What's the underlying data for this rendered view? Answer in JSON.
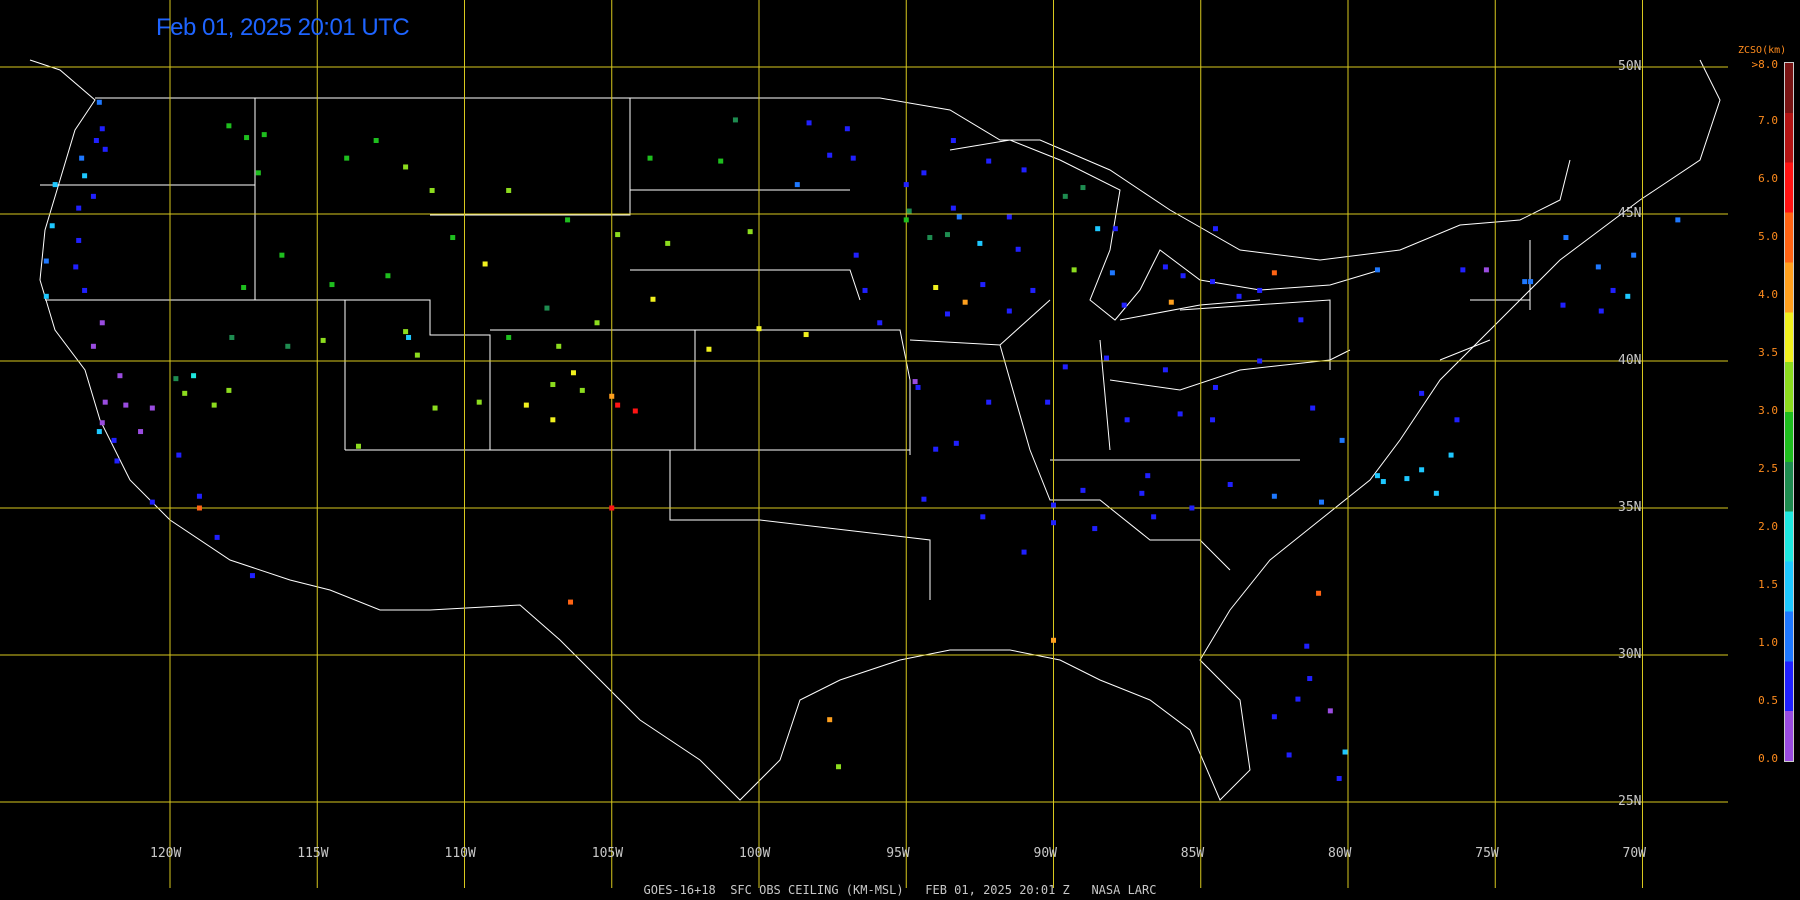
{
  "timestamp": "Feb 01, 2025 20:01 UTC",
  "footer": "GOES-16+18  SFC OBS CEILING (KM-MSL)   FEB 01, 2025 20:01 Z   NASA LARC",
  "map": {
    "lat_lines": [
      {
        "lat": 50,
        "label": "50N"
      },
      {
        "lat": 45,
        "label": "45N"
      },
      {
        "lat": 40,
        "label": "40N"
      },
      {
        "lat": 35,
        "label": "35N"
      },
      {
        "lat": 30,
        "label": "30N"
      },
      {
        "lat": 25,
        "label": "25N"
      }
    ],
    "lon_lines": [
      {
        "lon": -120,
        "label": "120W"
      },
      {
        "lon": -115,
        "label": "115W"
      },
      {
        "lon": -110,
        "label": "110W"
      },
      {
        "lon": -105,
        "label": "105W"
      },
      {
        "lon": -100,
        "label": "100W"
      },
      {
        "lon": -95,
        "label": "95W"
      },
      {
        "lon": -90,
        "label": "90W"
      },
      {
        "lon": -85,
        "label": "85W"
      },
      {
        "lon": -80,
        "label": "80W"
      },
      {
        "lon": -75,
        "label": "75W"
      },
      {
        "lon": -70,
        "label": "70W"
      }
    ],
    "grid_color": "#d8c81e",
    "border_color": "#ffffff"
  },
  "colorbar": {
    "title": "ZCSO(km)",
    "top_label": ">8.0",
    "ticks": [
      "0.0",
      "0.5",
      "1.0",
      "1.5",
      "2.0",
      "2.5",
      "3.0",
      "3.5",
      "4.0",
      "5.0",
      "6.0",
      "7.0"
    ],
    "colors": [
      "#9a4ce0",
      "#2020ff",
      "#1e78ff",
      "#1ec8ff",
      "#1ee8e0",
      "#1e8c50",
      "#1ebe1e",
      "#8cdc1e",
      "#f0f01e",
      "#ffa01e",
      "#ff6414",
      "#ff1414",
      "#b41414",
      "#781414"
    ],
    "label_color": "#ff8c1e"
  },
  "chart_data": {
    "type": "scatter",
    "units": "km",
    "points": [
      {
        "lon": -122.4,
        "lat": 48.8,
        "v": 1.2
      },
      {
        "lon": -122.3,
        "lat": 47.9,
        "v": 0.8
      },
      {
        "lon": -122.5,
        "lat": 47.5,
        "v": 0.8
      },
      {
        "lon": -122.2,
        "lat": 47.2,
        "v": 0.8
      },
      {
        "lon": -123.0,
        "lat": 46.9,
        "v": 1.0
      },
      {
        "lon": -122.9,
        "lat": 46.3,
        "v": 1.8
      },
      {
        "lon": -122.6,
        "lat": 45.6,
        "v": 0.8
      },
      {
        "lon": -123.1,
        "lat": 45.2,
        "v": 0.8
      },
      {
        "lon": -123.9,
        "lat": 46.0,
        "v": 1.8
      },
      {
        "lon": -124.0,
        "lat": 44.6,
        "v": 1.8
      },
      {
        "lon": -123.1,
        "lat": 44.1,
        "v": 0.8
      },
      {
        "lon": -123.2,
        "lat": 43.2,
        "v": 0.8
      },
      {
        "lon": -124.2,
        "lat": 43.4,
        "v": 1.2
      },
      {
        "lon": -124.2,
        "lat": 42.2,
        "v": 1.8
      },
      {
        "lon": -122.9,
        "lat": 42.4,
        "v": 0.8
      },
      {
        "lon": -122.3,
        "lat": 41.3,
        "v": 0.3
      },
      {
        "lon": -122.6,
        "lat": 40.5,
        "v": 0.3
      },
      {
        "lon": -121.7,
        "lat": 39.5,
        "v": 0.3
      },
      {
        "lon": -122.2,
        "lat": 38.6,
        "v": 0.3
      },
      {
        "lon": -121.5,
        "lat": 38.5,
        "v": 0.3
      },
      {
        "lon": -122.3,
        "lat": 37.9,
        "v": 0.3
      },
      {
        "lon": -122.4,
        "lat": 37.6,
        "v": 1.8
      },
      {
        "lon": -121.9,
        "lat": 37.3,
        "v": 0.8
      },
      {
        "lon": -121.8,
        "lat": 36.6,
        "v": 0.8
      },
      {
        "lon": -121.0,
        "lat": 37.6,
        "v": 0.3
      },
      {
        "lon": -120.6,
        "lat": 38.4,
        "v": 0.3
      },
      {
        "lon": -119.7,
        "lat": 36.8,
        "v": 0.8
      },
      {
        "lon": -120.6,
        "lat": 35.2,
        "v": 0.8
      },
      {
        "lon": -119.0,
        "lat": 35.4,
        "v": 0.8
      },
      {
        "lon": -118.4,
        "lat": 34.0,
        "v": 0.8
      },
      {
        "lon": -117.2,
        "lat": 32.7,
        "v": 0.8
      },
      {
        "lon": -119.2,
        "lat": 39.5,
        "v": 2.2
      },
      {
        "lon": -119.8,
        "lat": 39.4,
        "v": 2.7
      },
      {
        "lon": -119.5,
        "lat": 38.9,
        "v": 3.6
      },
      {
        "lon": -118.5,
        "lat": 38.5,
        "v": 3.6
      },
      {
        "lon": -118.0,
        "lat": 39.0,
        "v": 3.6
      },
      {
        "lon": -119.0,
        "lat": 35.0,
        "v": 6.5
      },
      {
        "lon": -117.9,
        "lat": 40.8,
        "v": 2.7
      },
      {
        "lon": -116.0,
        "lat": 40.5,
        "v": 2.7
      },
      {
        "lon": -114.8,
        "lat": 40.7,
        "v": 3.6
      },
      {
        "lon": -117.5,
        "lat": 42.5,
        "v": 3.0
      },
      {
        "lon": -116.2,
        "lat": 43.6,
        "v": 3.0
      },
      {
        "lon": -114.5,
        "lat": 42.6,
        "v": 3.0
      },
      {
        "lon": -112.6,
        "lat": 42.9,
        "v": 3.0
      },
      {
        "lon": -117.0,
        "lat": 46.4,
        "v": 3.0
      },
      {
        "lon": -117.4,
        "lat": 47.6,
        "v": 3.0
      },
      {
        "lon": -118.0,
        "lat": 48.0,
        "v": 3.0
      },
      {
        "lon": -116.8,
        "lat": 47.7,
        "v": 3.0
      },
      {
        "lon": -113.0,
        "lat": 47.5,
        "v": 3.0
      },
      {
        "lon": -114.0,
        "lat": 46.9,
        "v": 3.0
      },
      {
        "lon": -112.0,
        "lat": 46.6,
        "v": 3.6
      },
      {
        "lon": -111.1,
        "lat": 45.8,
        "v": 3.6
      },
      {
        "lon": -108.5,
        "lat": 45.8,
        "v": 3.6
      },
      {
        "lon": -110.4,
        "lat": 44.2,
        "v": 3.0
      },
      {
        "lon": -109.3,
        "lat": 43.3,
        "v": 4.5
      },
      {
        "lon": -106.5,
        "lat": 44.8,
        "v": 3.0
      },
      {
        "lon": -104.8,
        "lat": 44.3,
        "v": 3.6
      },
      {
        "lon": -105.5,
        "lat": 41.3,
        "v": 3.6
      },
      {
        "lon": -107.2,
        "lat": 41.8,
        "v": 2.7
      },
      {
        "lon": -108.5,
        "lat": 40.8,
        "v": 3.0
      },
      {
        "lon": -106.8,
        "lat": 40.5,
        "v": 3.6
      },
      {
        "lon": -106.3,
        "lat": 39.6,
        "v": 4.5
      },
      {
        "lon": -107.0,
        "lat": 39.2,
        "v": 3.6
      },
      {
        "lon": -106.0,
        "lat": 39.0,
        "v": 3.6
      },
      {
        "lon": -105.0,
        "lat": 38.8,
        "v": 5.5
      },
      {
        "lon": -104.8,
        "lat": 38.5,
        "v": 7.5
      },
      {
        "lon": -104.2,
        "lat": 38.3,
        "v": 7.5
      },
      {
        "lon": -107.9,
        "lat": 38.5,
        "v": 4.5
      },
      {
        "lon": -107.0,
        "lat": 38.0,
        "v": 4.5
      },
      {
        "lon": -112.0,
        "lat": 41.0,
        "v": 3.6
      },
      {
        "lon": -111.9,
        "lat": 40.8,
        "v": 1.8
      },
      {
        "lon": -111.6,
        "lat": 40.2,
        "v": 3.6
      },
      {
        "lon": -113.6,
        "lat": 37.1,
        "v": 3.6
      },
      {
        "lon": -111.0,
        "lat": 38.4,
        "v": 3.6
      },
      {
        "lon": -109.5,
        "lat": 38.6,
        "v": 3.6
      },
      {
        "lon": -103.7,
        "lat": 46.9,
        "v": 3.0
      },
      {
        "lon": -101.3,
        "lat": 46.8,
        "v": 3.0
      },
      {
        "lon": -100.8,
        "lat": 48.2,
        "v": 2.7
      },
      {
        "lon": -98.3,
        "lat": 48.1,
        "v": 0.8
      },
      {
        "lon": -97.0,
        "lat": 47.9,
        "v": 0.8
      },
      {
        "lon": -97.6,
        "lat": 47.0,
        "v": 0.8
      },
      {
        "lon": -96.8,
        "lat": 46.9,
        "v": 0.8
      },
      {
        "lon": -98.7,
        "lat": 46.0,
        "v": 1.2
      },
      {
        "lon": -100.3,
        "lat": 44.4,
        "v": 3.6
      },
      {
        "lon": -103.1,
        "lat": 44.0,
        "v": 3.6
      },
      {
        "lon": -96.7,
        "lat": 43.6,
        "v": 0.8
      },
      {
        "lon": -96.4,
        "lat": 42.4,
        "v": 0.8
      },
      {
        "lon": -95.9,
        "lat": 41.3,
        "v": 0.8
      },
      {
        "lon": -98.4,
        "lat": 40.9,
        "v": 4.5
      },
      {
        "lon": -100.0,
        "lat": 41.1,
        "v": 4.5
      },
      {
        "lon": -101.7,
        "lat": 40.4,
        "v": 4.5
      },
      {
        "lon": -103.6,
        "lat": 42.1,
        "v": 4.5
      },
      {
        "lon": -93.2,
        "lat": 44.9,
        "v": 1.2
      },
      {
        "lon": -93.4,
        "lat": 45.2,
        "v": 0.8
      },
      {
        "lon": -94.4,
        "lat": 46.4,
        "v": 0.8
      },
      {
        "lon": -92.2,
        "lat": 46.8,
        "v": 0.8
      },
      {
        "lon": -93.4,
        "lat": 47.5,
        "v": 0.8
      },
      {
        "lon": -95.0,
        "lat": 46.0,
        "v": 0.8
      },
      {
        "lon": -94.9,
        "lat": 45.1,
        "v": 2.7
      },
      {
        "lon": -93.6,
        "lat": 44.3,
        "v": 2.7
      },
      {
        "lon": -92.5,
        "lat": 44.0,
        "v": 1.8
      },
      {
        "lon": -94.2,
        "lat": 44.2,
        "v": 2.7
      },
      {
        "lon": -95.0,
        "lat": 44.8,
        "v": 3.0
      },
      {
        "lon": -91.5,
        "lat": 44.9,
        "v": 0.8
      },
      {
        "lon": -91.0,
        "lat": 46.5,
        "v": 0.8
      },
      {
        "lon": -89.6,
        "lat": 45.6,
        "v": 2.7
      },
      {
        "lon": -89.0,
        "lat": 45.9,
        "v": 2.7
      },
      {
        "lon": -88.5,
        "lat": 44.5,
        "v": 1.8
      },
      {
        "lon": -89.3,
        "lat": 43.1,
        "v": 3.6
      },
      {
        "lon": -88.0,
        "lat": 43.0,
        "v": 1.2
      },
      {
        "lon": -87.9,
        "lat": 44.5,
        "v": 0.8
      },
      {
        "lon": -87.6,
        "lat": 41.9,
        "v": 0.8
      },
      {
        "lon": -89.6,
        "lat": 39.8,
        "v": 0.8
      },
      {
        "lon": -88.2,
        "lat": 40.1,
        "v": 0.8
      },
      {
        "lon": -90.2,
        "lat": 38.6,
        "v": 0.8
      },
      {
        "lon": -91.2,
        "lat": 43.8,
        "v": 0.8
      },
      {
        "lon": -91.5,
        "lat": 41.7,
        "v": 0.8
      },
      {
        "lon": -93.6,
        "lat": 41.6,
        "v": 0.8
      },
      {
        "lon": -93.0,
        "lat": 42.0,
        "v": 5.0
      },
      {
        "lon": -94.0,
        "lat": 42.5,
        "v": 4.5
      },
      {
        "lon": -92.4,
        "lat": 42.6,
        "v": 0.8
      },
      {
        "lon": -90.7,
        "lat": 42.4,
        "v": 0.8
      },
      {
        "lon": -94.6,
        "lat": 39.1,
        "v": 0.8
      },
      {
        "lon": -94.7,
        "lat": 39.3,
        "v": 0.3
      },
      {
        "lon": -93.3,
        "lat": 37.2,
        "v": 0.8
      },
      {
        "lon": -92.2,
        "lat": 38.6,
        "v": 0.8
      },
      {
        "lon": -94.0,
        "lat": 37.0,
        "v": 0.8
      },
      {
        "lon": -92.4,
        "lat": 34.7,
        "v": 0.8
      },
      {
        "lon": -94.4,
        "lat": 35.3,
        "v": 0.8
      },
      {
        "lon": -90.0,
        "lat": 35.1,
        "v": 0.8
      },
      {
        "lon": -89.0,
        "lat": 35.6,
        "v": 0.8
      },
      {
        "lon": -86.8,
        "lat": 36.1,
        "v": 0.8
      },
      {
        "lon": -85.3,
        "lat": 35.0,
        "v": 0.8
      },
      {
        "lon": -84.0,
        "lat": 35.8,
        "v": 0.8
      },
      {
        "lon": -86.6,
        "lat": 34.7,
        "v": 0.8
      },
      {
        "lon": -87.0,
        "lat": 35.5,
        "v": 0.8
      },
      {
        "lon": -88.6,
        "lat": 34.3,
        "v": 0.8
      },
      {
        "lon": -90.0,
        "lat": 34.5,
        "v": 0.8
      },
      {
        "lon": -91.0,
        "lat": 33.5,
        "v": 0.8
      },
      {
        "lon": -85.7,
        "lat": 38.2,
        "v": 0.8
      },
      {
        "lon": -84.6,
        "lat": 38.0,
        "v": 0.8
      },
      {
        "lon": -84.5,
        "lat": 39.1,
        "v": 0.8
      },
      {
        "lon": -83.0,
        "lat": 40.0,
        "v": 0.8
      },
      {
        "lon": -81.6,
        "lat": 41.4,
        "v": 0.8
      },
      {
        "lon": -83.7,
        "lat": 42.2,
        "v": 0.8
      },
      {
        "lon": -83.0,
        "lat": 42.4,
        "v": 0.8
      },
      {
        "lon": -85.6,
        "lat": 42.9,
        "v": 0.8
      },
      {
        "lon": -84.6,
        "lat": 42.7,
        "v": 0.8
      },
      {
        "lon": -86.2,
        "lat": 43.2,
        "v": 0.8
      },
      {
        "lon": -84.5,
        "lat": 44.5,
        "v": 0.8
      },
      {
        "lon": -82.5,
        "lat": 43.0,
        "v": 6.5
      },
      {
        "lon": -86.0,
        "lat": 42.0,
        "v": 5.5
      },
      {
        "lon": -86.2,
        "lat": 39.7,
        "v": 0.8
      },
      {
        "lon": -87.5,
        "lat": 38.0,
        "v": 0.8
      },
      {
        "lon": -81.2,
        "lat": 38.4,
        "v": 0.8
      },
      {
        "lon": -80.2,
        "lat": 37.3,
        "v": 1.2
      },
      {
        "lon": -78.0,
        "lat": 36.0,
        "v": 1.8
      },
      {
        "lon": -79.0,
        "lat": 36.1,
        "v": 1.8
      },
      {
        "lon": -77.5,
        "lat": 36.3,
        "v": 1.8
      },
      {
        "lon": -76.5,
        "lat": 36.8,
        "v": 1.8
      },
      {
        "lon": -77.0,
        "lat": 35.5,
        "v": 1.8
      },
      {
        "lon": -78.8,
        "lat": 35.9,
        "v": 1.8
      },
      {
        "lon": -80.9,
        "lat": 35.2,
        "v": 1.2
      },
      {
        "lon": -82.5,
        "lat": 35.4,
        "v": 1.2
      },
      {
        "lon": -77.5,
        "lat": 38.9,
        "v": 0.8
      },
      {
        "lon": -76.3,
        "lat": 38.0,
        "v": 0.8
      },
      {
        "lon": -74.0,
        "lat": 42.7,
        "v": 1.2
      },
      {
        "lon": -73.8,
        "lat": 42.7,
        "v": 1.2
      },
      {
        "lon": -75.3,
        "lat": 43.1,
        "v": 0.3
      },
      {
        "lon": -76.1,
        "lat": 43.1,
        "v": 0.8
      },
      {
        "lon": -79.0,
        "lat": 43.1,
        "v": 1.2
      },
      {
        "lon": -71.0,
        "lat": 42.4,
        "v": 0.8
      },
      {
        "lon": -71.4,
        "lat": 41.7,
        "v": 0.8
      },
      {
        "lon": -72.7,
        "lat": 41.9,
        "v": 0.8
      },
      {
        "lon": -70.5,
        "lat": 42.2,
        "v": 1.8
      },
      {
        "lon": -70.3,
        "lat": 43.6,
        "v": 1.2
      },
      {
        "lon": -68.8,
        "lat": 44.8,
        "v": 1.2
      },
      {
        "lon": -72.6,
        "lat": 44.2,
        "v": 1.2
      },
      {
        "lon": -71.5,
        "lat": 43.2,
        "v": 1.2
      },
      {
        "lon": -81.0,
        "lat": 32.1,
        "v": 6.5
      },
      {
        "lon": -90.0,
        "lat": 30.5,
        "v": 5.0
      },
      {
        "lon": -97.6,
        "lat": 27.8,
        "v": 5.0
      },
      {
        "lon": -97.3,
        "lat": 26.2,
        "v": 3.6
      },
      {
        "lon": -106.4,
        "lat": 31.8,
        "v": 6.5
      },
      {
        "lon": -105.0,
        "lat": 35.0,
        "v": 7.5
      },
      {
        "lon": -81.7,
        "lat": 28.5,
        "v": 0.8
      },
      {
        "lon": -82.5,
        "lat": 27.9,
        "v": 0.8
      },
      {
        "lon": -81.3,
        "lat": 29.2,
        "v": 0.8
      },
      {
        "lon": -80.6,
        "lat": 28.1,
        "v": 0.3
      },
      {
        "lon": -80.1,
        "lat": 26.7,
        "v": 1.8
      },
      {
        "lon": -80.3,
        "lat": 25.8,
        "v": 0.8
      },
      {
        "lon": -82.0,
        "lat": 26.6,
        "v": 0.8
      },
      {
        "lon": -81.4,
        "lat": 30.3,
        "v": 0.8
      }
    ]
  }
}
